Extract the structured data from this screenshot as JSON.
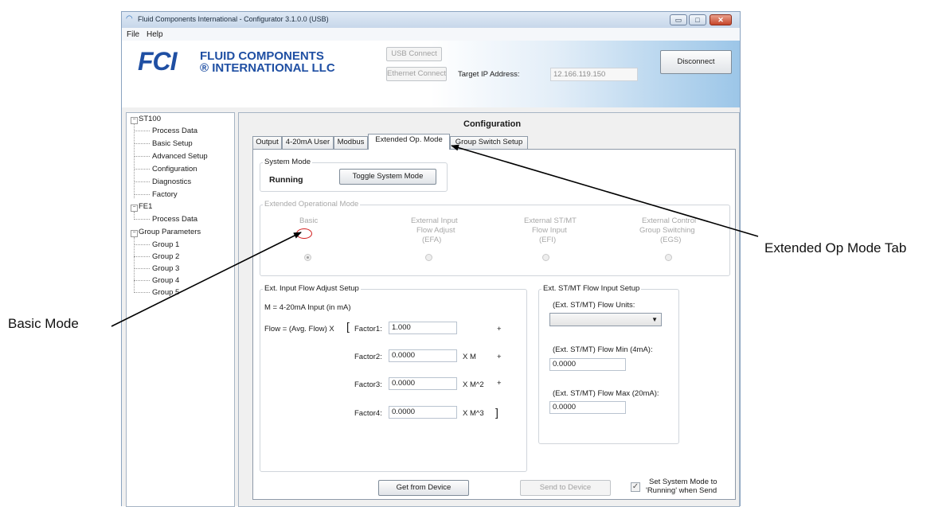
{
  "window": {
    "title": "Fluid Components International - Configurator 3.1.0.0 (USB)",
    "controls": {
      "minimize": "▭",
      "maximize": "□",
      "close": "✕"
    }
  },
  "menu": {
    "file": "File",
    "help": "Help"
  },
  "banner": {
    "logo_mark": "FCI",
    "logo_line1": "FLUID COMPONENTS",
    "logo_line2": "® INTERNATIONAL LLC",
    "usb_connect": "USB Connect",
    "ethernet_connect": "Ethernet Connect",
    "target_ip_label": "Target IP Address:",
    "target_ip_value": "12.166.119.150",
    "disconnect": "Disconnect"
  },
  "tree": {
    "st100": "ST100",
    "st100_children": [
      "Process Data",
      "Basic Setup",
      "Advanced Setup",
      "Configuration",
      "Diagnostics",
      "Factory"
    ],
    "fe1": "FE1",
    "fe1_children": [
      "Process Data"
    ],
    "group_params": "Group Parameters",
    "groups": [
      "Group 1",
      "Group 2",
      "Group 3",
      "Group 4",
      "Group 5"
    ]
  },
  "main": {
    "heading": "Configuration",
    "tabs": [
      "Output",
      "4-20mA User",
      "Modbus",
      "Extended Op. Mode",
      "Group Switch Setup"
    ],
    "active_tab": "Extended Op. Mode",
    "system_mode": {
      "legend": "System Mode",
      "status": "Running",
      "toggle_button": "Toggle System Mode"
    },
    "ext_op_mode": {
      "legend": "Extended Operational Mode",
      "basic": "Basic",
      "efa_line1": "External Input",
      "efa_line2": "Flow Adjust",
      "efa_line3": "(EFA)",
      "efi_line1": "External ST/MT",
      "efi_line2": "Flow Input",
      "efi_line3": "(EFI)",
      "egs_line1": "External Control",
      "egs_line2": "Group Switching",
      "egs_line3": "(EGS)",
      "selected": "Basic"
    },
    "flow_adjust": {
      "legend": "Ext. Input Flow Adjust Setup",
      "m_def": "M = 4-20mA Input (in mA)",
      "flow_eq": "Flow = (Avg. Flow) X",
      "open_bracket": "[",
      "close_bracket": "]",
      "factor1_label": "Factor1:",
      "factor1_value": "1.000",
      "factor2_label": "Factor2:",
      "factor2_value": "0.0000",
      "factor2_suffix": "X M",
      "factor3_label": "Factor3:",
      "factor3_value": "0.0000",
      "factor3_suffix": "X M^2",
      "factor4_label": "Factor4:",
      "factor4_value": "0.0000",
      "factor4_suffix": "X M^3",
      "plus": "+"
    },
    "flow_input": {
      "legend": "Ext. ST/MT Flow Input Setup",
      "units_label": "(Ext. ST/MT) Flow Units:",
      "units_value": "",
      "min_label": "(Ext. ST/MT) Flow Min (4mA):",
      "min_value": "0.0000",
      "max_label": "(Ext. ST/MT) Flow Max (20mA):",
      "max_value": "0.0000"
    },
    "get_button": "Get from Device",
    "send_button": "Send to Device",
    "set_mode_line1": "Set System Mode to",
    "set_mode_line2": "'Running' when Send",
    "set_mode_checked": "✓"
  },
  "annotations": {
    "tab_callout": "Extended Op Mode Tab",
    "basic_callout": "Basic Mode"
  }
}
